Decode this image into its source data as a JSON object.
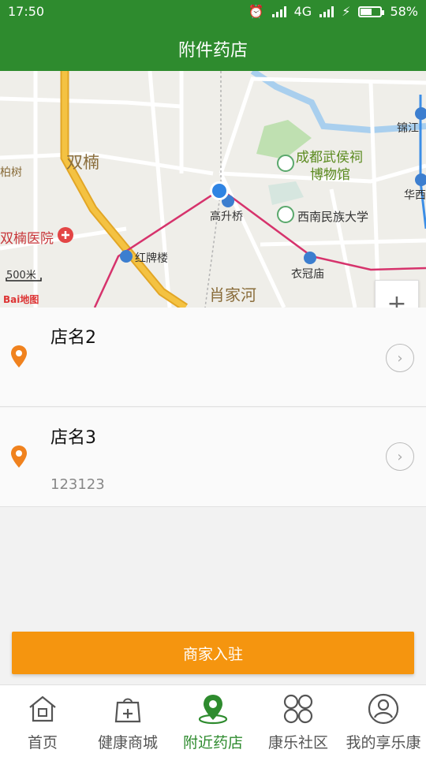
{
  "status_bar": {
    "time": "17:50",
    "network": "4G",
    "battery": "58%",
    "battery_level": 0.58
  },
  "header": {
    "title": "附件药店"
  },
  "map": {
    "labels": {
      "shuangnan": "双楠",
      "chengdu_wuhouci": "成都武侯祠",
      "bowuguan": "博物馆",
      "jinjiang": "锦江",
      "huaxi": "华西",
      "gaoshengqiao": "高升桥",
      "xinan_minzu": "西南民族大学",
      "shuangnan_hospital": "双楠医院",
      "hongpailou": "红牌楼",
      "yiguanmiao": "衣冠庙",
      "xiaojiahe": "肖家河",
      "baishu": "柏树",
      "scale": "500米",
      "logo": "Bai地图"
    },
    "zoom_in": "+",
    "zoom_out": "−",
    "colors": {
      "metro": "#d6336c",
      "road_major": "#f4c242",
      "water": "#a9cfee",
      "park": "#bfe0b1"
    }
  },
  "stores": [
    {
      "name": "店名2",
      "address": ""
    },
    {
      "name": "店名3",
      "address": "123123"
    }
  ],
  "join_button": {
    "label": "商家入驻"
  },
  "tabs": [
    {
      "label": "首页",
      "icon": "home-icon",
      "active": false
    },
    {
      "label": "健康商城",
      "icon": "shopping-bag-icon",
      "active": false
    },
    {
      "label": "附近药店",
      "icon": "location-pin-icon",
      "active": true
    },
    {
      "label": "康乐社区",
      "icon": "community-icon",
      "active": false
    },
    {
      "label": "我的享乐康",
      "icon": "user-icon",
      "active": false
    }
  ],
  "accent_color": "#2e8b2e",
  "button_color": "#f5950f",
  "pin_color": "#f0821e"
}
